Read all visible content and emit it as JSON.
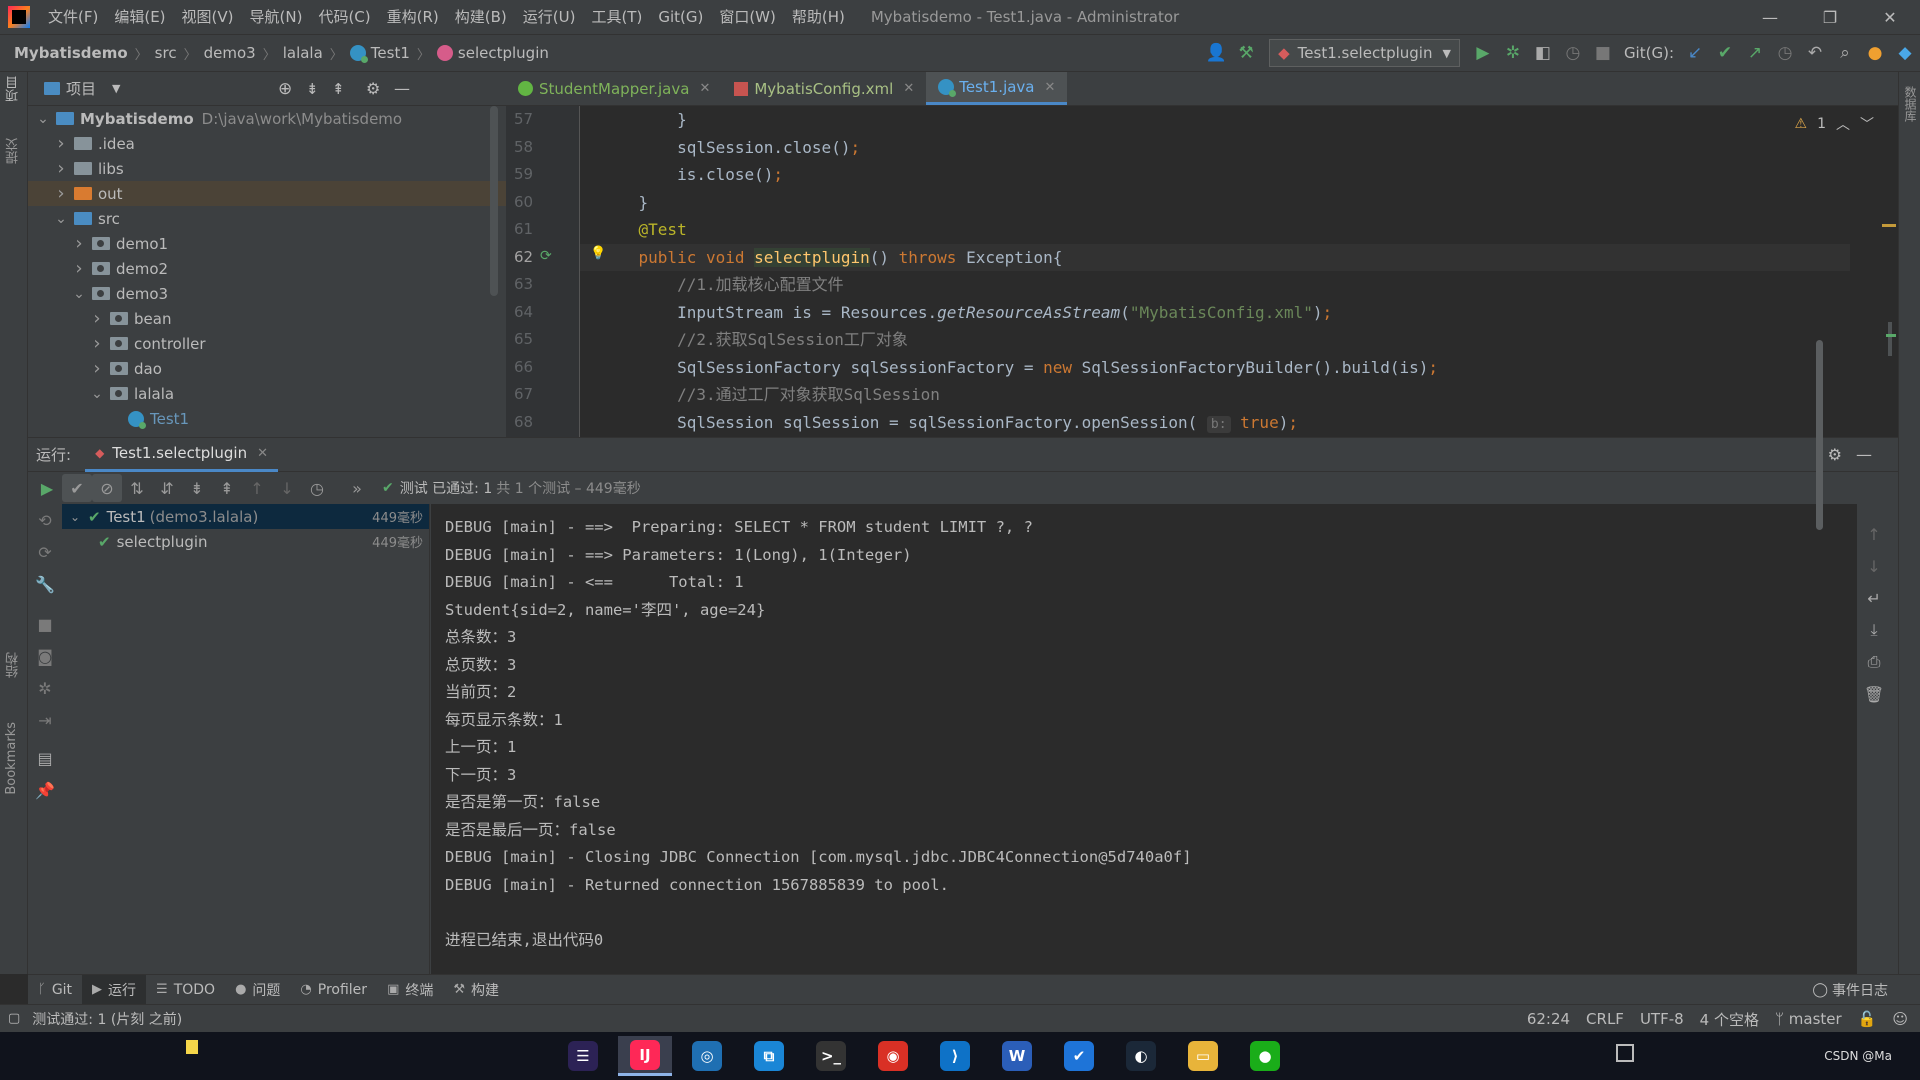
{
  "window": {
    "menus": [
      "文件(F)",
      "编辑(E)",
      "视图(V)",
      "导航(N)",
      "代码(C)",
      "重构(R)",
      "构建(B)",
      "运行(U)",
      "工具(T)",
      "Git(G)",
      "窗口(W)",
      "帮助(H)"
    ],
    "title": "Mybatisdemo - Test1.java - Administrator",
    "controls": [
      "—",
      "❐",
      "✕"
    ]
  },
  "navbar": {
    "crumbs": [
      "Mybatisdemo",
      "src",
      "demo3",
      "lalala",
      "Test1",
      "selectplugin"
    ],
    "run_config": "Test1.selectplugin",
    "git_label": "Git(G):"
  },
  "left_stripe": {
    "project": "项目",
    "commit": "提交",
    "structure": "结构",
    "bookmarks": "Bookmarks"
  },
  "right_stripe": {
    "database": "数据库"
  },
  "project": {
    "header": "项目",
    "tree": [
      {
        "name": "Mybatisdemo",
        "hint": "D:\\java\\work\\Mybatisdemo",
        "depth": 0,
        "expanded": true,
        "icon": "module"
      },
      {
        "name": ".idea",
        "depth": 1,
        "expanded": false,
        "icon": "folder"
      },
      {
        "name": "libs",
        "depth": 1,
        "expanded": false,
        "icon": "folder"
      },
      {
        "name": "out",
        "depth": 1,
        "expanded": false,
        "icon": "folder-orange",
        "selected": true
      },
      {
        "name": "src",
        "depth": 1,
        "expanded": true,
        "icon": "folder-blue"
      },
      {
        "name": "demo1",
        "depth": 2,
        "expanded": false,
        "icon": "package"
      },
      {
        "name": "demo2",
        "depth": 2,
        "expanded": false,
        "icon": "package"
      },
      {
        "name": "demo3",
        "depth": 2,
        "expanded": true,
        "icon": "package"
      },
      {
        "name": "bean",
        "depth": 3,
        "expanded": false,
        "icon": "package"
      },
      {
        "name": "controller",
        "depth": 3,
        "expanded": false,
        "icon": "package"
      },
      {
        "name": "dao",
        "depth": 3,
        "expanded": false,
        "icon": "package"
      },
      {
        "name": "lalala",
        "depth": 3,
        "expanded": true,
        "icon": "package"
      },
      {
        "name": "Test1",
        "depth": 4,
        "icon": "class"
      }
    ]
  },
  "editor": {
    "tabs": [
      {
        "label": "StudentMapper.java",
        "icon": "interface-icon",
        "active": false
      },
      {
        "label": "MybatisConfig.xml",
        "icon": "xml-icon",
        "active": false
      },
      {
        "label": "Test1.java",
        "icon": "class-icon",
        "active": true
      }
    ],
    "warnings": "1",
    "current_line": 62,
    "lines": [
      {
        "no": 57,
        "tokens": [
          {
            "t": "        }",
            "c": ""
          }
        ]
      },
      {
        "no": 58,
        "tokens": [
          {
            "t": "        sqlSession.close()",
            "c": ""
          },
          {
            "t": ";",
            "c": "kw"
          }
        ]
      },
      {
        "no": 59,
        "tokens": [
          {
            "t": "        is.close()",
            "c": ""
          },
          {
            "t": ";",
            "c": "kw"
          }
        ]
      },
      {
        "no": 60,
        "tokens": [
          {
            "t": "    }",
            "c": ""
          }
        ]
      },
      {
        "no": 61,
        "tokens": [
          {
            "t": "    @Test",
            "c": "ann"
          }
        ]
      },
      {
        "no": 62,
        "tokens": [
          {
            "t": "    public void ",
            "c": "kw"
          },
          {
            "t": "selectplugin",
            "c": "fn"
          },
          {
            "t": "() ",
            "c": ""
          },
          {
            "t": "throws ",
            "c": "kw"
          },
          {
            "t": "Exception{",
            "c": ""
          }
        ]
      },
      {
        "no": 63,
        "tokens": [
          {
            "t": "        //1.加载核心配置文件",
            "c": "cmt"
          }
        ]
      },
      {
        "no": 64,
        "tokens": [
          {
            "t": "        InputStream is = Resources.",
            "c": ""
          },
          {
            "t": "getResourceAsStream",
            "c": "it"
          },
          {
            "t": "(",
            "c": ""
          },
          {
            "t": "\"MybatisConfig.xml\"",
            "c": "str"
          },
          {
            "t": ")",
            "c": ""
          },
          {
            "t": ";",
            "c": "kw"
          }
        ]
      },
      {
        "no": 65,
        "tokens": [
          {
            "t": "        //2.获取SqlSession工厂对象",
            "c": "cmt"
          }
        ]
      },
      {
        "no": 66,
        "tokens": [
          {
            "t": "        SqlSessionFactory sqlSessionFactory = ",
            "c": ""
          },
          {
            "t": "new ",
            "c": "kw"
          },
          {
            "t": "SqlSessionFactoryBuilder().build(is)",
            "c": ""
          },
          {
            "t": ";",
            "c": "kw"
          }
        ]
      },
      {
        "no": 67,
        "tokens": [
          {
            "t": "        //3.通过工厂对象获取SqlSession",
            "c": "cmt"
          }
        ]
      },
      {
        "no": 68,
        "tokens": [
          {
            "t": "        SqlSession sqlSession = sqlSessionFactory.openSession( ",
            "c": ""
          },
          {
            "t": "b:",
            "c": "hint"
          },
          {
            "t": " true",
            "c": "kw"
          },
          {
            "t": ")",
            "c": ""
          },
          {
            "t": ";",
            "c": "kw"
          }
        ]
      }
    ]
  },
  "run": {
    "label": "运行:",
    "tab": "Test1.selectplugin",
    "status_main": "测试 已通过: 1",
    "status_detail": "共 1 个测试 – 449毫秒",
    "tests": [
      {
        "name": "Test1",
        "hint": "(demo3.lalala)",
        "time": "449毫秒",
        "depth": 0,
        "selected": true
      },
      {
        "name": "selectplugin",
        "hint": "",
        "time": "449毫秒",
        "depth": 1,
        "selected": false
      }
    ],
    "console": [
      "DEBUG [main] - ==>  Preparing: SELECT * FROM student LIMIT ?, ?",
      "DEBUG [main] - ==> Parameters: 1(Long), 1(Integer)",
      "DEBUG [main] - <==      Total: 1",
      "Student{sid=2, name='李四', age=24}",
      "总条数：3",
      "总页数：3",
      "当前页：2",
      "每页显示条数：1",
      "上一页：1",
      "下一页：3",
      "是否是第一页：false",
      "是否是最后一页：false",
      "DEBUG [main] - Closing JDBC Connection [com.mysql.jdbc.JDBC4Connection@5d740a0f]",
      "DEBUG [main] - Returned connection 1567885839 to pool.",
      "",
      "进程已结束,退出代码0"
    ]
  },
  "tool_tabs": [
    {
      "label": "Git",
      "icon": "ᚴ",
      "active": false
    },
    {
      "label": "运行",
      "icon": "▶",
      "active": true
    },
    {
      "label": "TODO",
      "icon": "☰",
      "active": false
    },
    {
      "label": "问题",
      "icon": "●",
      "active": false
    },
    {
      "label": "Profiler",
      "icon": "◔",
      "active": false
    },
    {
      "label": "终端",
      "icon": "▣",
      "active": false
    },
    {
      "label": "构建",
      "icon": "⚒",
      "active": false
    }
  ],
  "event_log": "事件日志",
  "status": {
    "message": "测试通过: 1 (片刻 之前)",
    "position": "62:24",
    "line_sep": "CRLF",
    "encoding": "UTF-8",
    "indent": "4 个空格",
    "branch": "master"
  },
  "taskbar": {
    "apps": [
      {
        "name": "eclipse-icon",
        "glyph": "☰",
        "color": "#2c2255"
      },
      {
        "name": "intellij-icon",
        "glyph": "IJ",
        "color": "#fe2857",
        "active": true
      },
      {
        "name": "browser-icon",
        "glyph": "◎",
        "color": "#1f6fb2"
      },
      {
        "name": "remote-icon",
        "glyph": "⧉",
        "color": "#1a86d6"
      },
      {
        "name": "terminal-icon",
        "glyph": ">_",
        "color": "#333"
      },
      {
        "name": "chrome-icon",
        "glyph": "◉",
        "color": "#d93025"
      },
      {
        "name": "vscode-icon",
        "glyph": "⟩",
        "color": "#0e72c7"
      },
      {
        "name": "word-icon",
        "glyph": "W",
        "color": "#2b5eb8"
      },
      {
        "name": "todo-icon",
        "glyph": "✔",
        "color": "#1e74d8"
      },
      {
        "name": "steam-icon",
        "glyph": "◐",
        "color": "#1b2838"
      },
      {
        "name": "explorer-icon",
        "glyph": "▭",
        "color": "#e8b43a"
      },
      {
        "name": "wechat-icon",
        "glyph": "●",
        "color": "#1aad19"
      }
    ],
    "tray_text": "CSDN @Ma"
  }
}
